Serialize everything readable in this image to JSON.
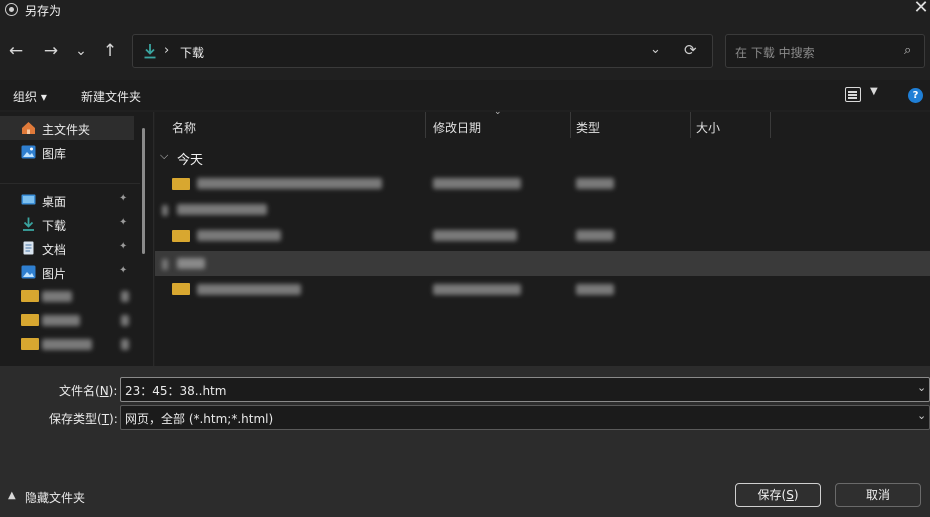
{
  "window": {
    "title": "另存为",
    "close_label": "✕"
  },
  "nav": {
    "back": "←",
    "forward": "→",
    "recent": "⌄",
    "up": "↑",
    "address": {
      "separator": "›",
      "location": "下载",
      "dropdown": "⌄",
      "refresh": "⟳"
    },
    "search": {
      "placeholder": "在 下载 中搜索",
      "icon": "⌕"
    }
  },
  "toolbar": {
    "organize": "组织 ▾",
    "new_folder": "新建文件夹",
    "help": "?"
  },
  "sidebar": {
    "items": [
      {
        "label": "主文件夹",
        "icon": "home-icon"
      },
      {
        "label": "图库",
        "icon": "gallery-icon"
      },
      {
        "label": "桌面",
        "icon": "desktop-icon",
        "pinned": true
      },
      {
        "label": "下载",
        "icon": "download-icon",
        "pinned": true
      },
      {
        "label": "文档",
        "icon": "document-icon",
        "pinned": true
      },
      {
        "label": "图片",
        "icon": "pictures-icon",
        "pinned": true
      }
    ],
    "pin_glyph": "✦"
  },
  "columns": {
    "name": "名称",
    "modified": "修改日期",
    "type": "类型",
    "size": "大小"
  },
  "groups": {
    "today": "今天"
  },
  "form": {
    "filename_label": "文件名(",
    "filename_key": "N",
    "filename_tail": "):",
    "filename_value": "23：45：38..htm",
    "filetype_label": "保存类型(",
    "filetype_key": "T",
    "filetype_tail": "):",
    "filetype_value": "网页，全部 (*.htm;*.html)"
  },
  "footer": {
    "hide_folders": "隐藏文件夹",
    "save": "保存(",
    "save_key": "S",
    "save_tail": ")",
    "cancel": "取消"
  },
  "colors": {
    "folder": "#d8a730",
    "accent": "#1f7fd6",
    "download": "#3aa4a0"
  }
}
